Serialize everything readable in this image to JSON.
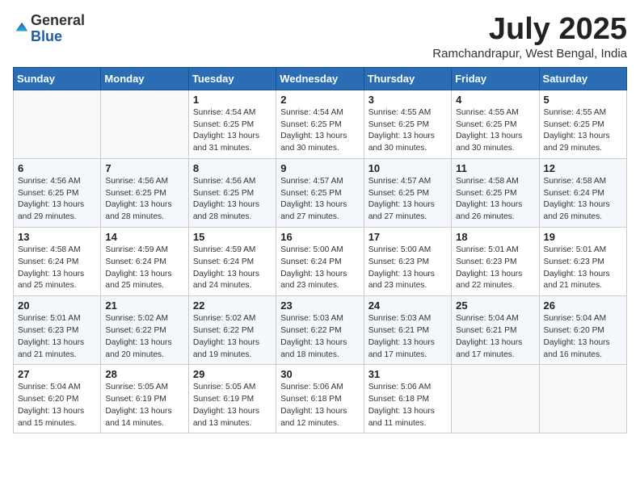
{
  "header": {
    "logo_general": "General",
    "logo_blue": "Blue",
    "month": "July 2025",
    "location": "Ramchandrapur, West Bengal, India"
  },
  "weekdays": [
    "Sunday",
    "Monday",
    "Tuesday",
    "Wednesday",
    "Thursday",
    "Friday",
    "Saturday"
  ],
  "weeks": [
    [
      {
        "day": "",
        "info": ""
      },
      {
        "day": "",
        "info": ""
      },
      {
        "day": "1",
        "info": "Sunrise: 4:54 AM\nSunset: 6:25 PM\nDaylight: 13 hours and 31 minutes."
      },
      {
        "day": "2",
        "info": "Sunrise: 4:54 AM\nSunset: 6:25 PM\nDaylight: 13 hours and 30 minutes."
      },
      {
        "day": "3",
        "info": "Sunrise: 4:55 AM\nSunset: 6:25 PM\nDaylight: 13 hours and 30 minutes."
      },
      {
        "day": "4",
        "info": "Sunrise: 4:55 AM\nSunset: 6:25 PM\nDaylight: 13 hours and 30 minutes."
      },
      {
        "day": "5",
        "info": "Sunrise: 4:55 AM\nSunset: 6:25 PM\nDaylight: 13 hours and 29 minutes."
      }
    ],
    [
      {
        "day": "6",
        "info": "Sunrise: 4:56 AM\nSunset: 6:25 PM\nDaylight: 13 hours and 29 minutes."
      },
      {
        "day": "7",
        "info": "Sunrise: 4:56 AM\nSunset: 6:25 PM\nDaylight: 13 hours and 28 minutes."
      },
      {
        "day": "8",
        "info": "Sunrise: 4:56 AM\nSunset: 6:25 PM\nDaylight: 13 hours and 28 minutes."
      },
      {
        "day": "9",
        "info": "Sunrise: 4:57 AM\nSunset: 6:25 PM\nDaylight: 13 hours and 27 minutes."
      },
      {
        "day": "10",
        "info": "Sunrise: 4:57 AM\nSunset: 6:25 PM\nDaylight: 13 hours and 27 minutes."
      },
      {
        "day": "11",
        "info": "Sunrise: 4:58 AM\nSunset: 6:25 PM\nDaylight: 13 hours and 26 minutes."
      },
      {
        "day": "12",
        "info": "Sunrise: 4:58 AM\nSunset: 6:24 PM\nDaylight: 13 hours and 26 minutes."
      }
    ],
    [
      {
        "day": "13",
        "info": "Sunrise: 4:58 AM\nSunset: 6:24 PM\nDaylight: 13 hours and 25 minutes."
      },
      {
        "day": "14",
        "info": "Sunrise: 4:59 AM\nSunset: 6:24 PM\nDaylight: 13 hours and 25 minutes."
      },
      {
        "day": "15",
        "info": "Sunrise: 4:59 AM\nSunset: 6:24 PM\nDaylight: 13 hours and 24 minutes."
      },
      {
        "day": "16",
        "info": "Sunrise: 5:00 AM\nSunset: 6:24 PM\nDaylight: 13 hours and 23 minutes."
      },
      {
        "day": "17",
        "info": "Sunrise: 5:00 AM\nSunset: 6:23 PM\nDaylight: 13 hours and 23 minutes."
      },
      {
        "day": "18",
        "info": "Sunrise: 5:01 AM\nSunset: 6:23 PM\nDaylight: 13 hours and 22 minutes."
      },
      {
        "day": "19",
        "info": "Sunrise: 5:01 AM\nSunset: 6:23 PM\nDaylight: 13 hours and 21 minutes."
      }
    ],
    [
      {
        "day": "20",
        "info": "Sunrise: 5:01 AM\nSunset: 6:23 PM\nDaylight: 13 hours and 21 minutes."
      },
      {
        "day": "21",
        "info": "Sunrise: 5:02 AM\nSunset: 6:22 PM\nDaylight: 13 hours and 20 minutes."
      },
      {
        "day": "22",
        "info": "Sunrise: 5:02 AM\nSunset: 6:22 PM\nDaylight: 13 hours and 19 minutes."
      },
      {
        "day": "23",
        "info": "Sunrise: 5:03 AM\nSunset: 6:22 PM\nDaylight: 13 hours and 18 minutes."
      },
      {
        "day": "24",
        "info": "Sunrise: 5:03 AM\nSunset: 6:21 PM\nDaylight: 13 hours and 17 minutes."
      },
      {
        "day": "25",
        "info": "Sunrise: 5:04 AM\nSunset: 6:21 PM\nDaylight: 13 hours and 17 minutes."
      },
      {
        "day": "26",
        "info": "Sunrise: 5:04 AM\nSunset: 6:20 PM\nDaylight: 13 hours and 16 minutes."
      }
    ],
    [
      {
        "day": "27",
        "info": "Sunrise: 5:04 AM\nSunset: 6:20 PM\nDaylight: 13 hours and 15 minutes."
      },
      {
        "day": "28",
        "info": "Sunrise: 5:05 AM\nSunset: 6:19 PM\nDaylight: 13 hours and 14 minutes."
      },
      {
        "day": "29",
        "info": "Sunrise: 5:05 AM\nSunset: 6:19 PM\nDaylight: 13 hours and 13 minutes."
      },
      {
        "day": "30",
        "info": "Sunrise: 5:06 AM\nSunset: 6:18 PM\nDaylight: 13 hours and 12 minutes."
      },
      {
        "day": "31",
        "info": "Sunrise: 5:06 AM\nSunset: 6:18 PM\nDaylight: 13 hours and 11 minutes."
      },
      {
        "day": "",
        "info": ""
      },
      {
        "day": "",
        "info": ""
      }
    ]
  ]
}
